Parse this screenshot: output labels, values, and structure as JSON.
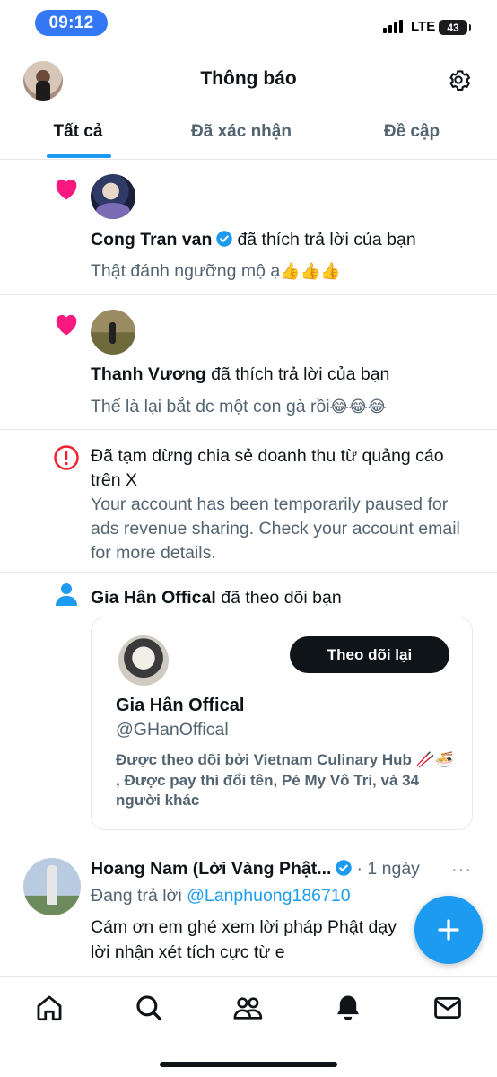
{
  "status_bar": {
    "time": "09:12",
    "network": "LTE",
    "battery": "43"
  },
  "header": {
    "title": "Thông báo"
  },
  "tabs": [
    {
      "label": "Tất cả",
      "active": true
    },
    {
      "label": "Đã xác nhận",
      "active": false
    },
    {
      "label": "Đề cập",
      "active": false
    }
  ],
  "notifications": [
    {
      "type": "like",
      "user": "Cong Tran van",
      "verified": true,
      "action": "đã thích trả lời của bạn",
      "text": "Thật đánh ngưỡng mộ ạ",
      "emoji": "👍👍👍"
    },
    {
      "type": "like",
      "user": "Thanh Vương",
      "verified": false,
      "action": "đã thích trả lời của bạn",
      "text": "Thế là lại bắt dc một con gà rồi",
      "emoji": "😂😂😂"
    }
  ],
  "alert": {
    "title": "Đã tạm dừng chia sẻ doanh thu từ quảng cáo trên X",
    "body": "Your account has been temporarily paused for ads revenue sharing. Check your account email for more details."
  },
  "follow": {
    "user": "Gia Hân Offical",
    "action": "đã theo dõi bạn",
    "follow_back_label": "Theo dõi lại",
    "card_name": "Gia Hân Offical",
    "card_handle": "@GHanOffical",
    "followed_by": "Được theo dõi bởi Vietnam Culinary Hub 🥢🍜 , Được pay thì đổi tên, Pé My Vô Tri, và 34 người khác"
  },
  "reply": {
    "user": "Hoang Nam (Lời Vàng Phật...",
    "verified": true,
    "time": "· 1 ngày",
    "replying_prefix": "Đang trả lời",
    "replying_to": "@Lanphuong186710",
    "text_line1": "Cám ơn em ghé xem lời pháp Phật dạy",
    "text_line2": "lời nhận xét tích cực từ e",
    "more": "···"
  },
  "icons": {
    "heart": "heart-icon",
    "alert": "alert-icon",
    "person": "person-icon",
    "verified": "verified-badge-icon",
    "compose": "compose-plus-icon",
    "nav": [
      "home-icon",
      "search-icon",
      "communities-icon",
      "notifications-bell-icon",
      "messages-icon"
    ]
  },
  "colors": {
    "accent": "#1d9bf0",
    "heart": "#f91880",
    "alert": "#f4212e",
    "text": "#0f1419",
    "muted": "#536471"
  }
}
